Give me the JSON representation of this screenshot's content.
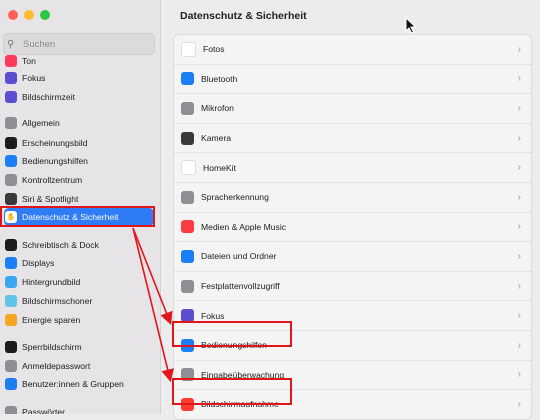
{
  "window": {
    "traffic_lights": [
      {
        "name": "close",
        "color": "#ff5f57"
      },
      {
        "name": "minimize",
        "color": "#febc2e"
      },
      {
        "name": "zoom",
        "color": "#28c840"
      }
    ]
  },
  "sidebar": {
    "search_placeholder": "Suchen",
    "items": [
      {
        "label": "Ton",
        "icon": "speaker-icon",
        "color": "#ff3b5c"
      },
      {
        "label": "Fokus",
        "icon": "moon-icon",
        "color": "#5b4fcf"
      },
      {
        "label": "Bildschirmzeit",
        "icon": "hourglass-icon",
        "color": "#5b4fcf"
      },
      {
        "label": "Allgemein",
        "icon": "gear-icon",
        "color": "#8e8e93"
      },
      {
        "label": "Erscheinungsbild",
        "icon": "appearance-icon",
        "color": "#1c1c1e"
      },
      {
        "label": "Bedienungshilfen",
        "icon": "accessibility-icon",
        "color": "#1a7ef5"
      },
      {
        "label": "Kontrollzentrum",
        "icon": "control-center-icon",
        "color": "#8e8e93"
      },
      {
        "label": "Siri & Spotlight",
        "icon": "siri-icon",
        "color": "#3a3a3c"
      },
      {
        "label": "Datenschutz & Sicherheit",
        "icon": "hand-icon",
        "color": "#2f7cf6",
        "active": true
      },
      {
        "label": "Schreibtisch & Dock",
        "icon": "dock-icon",
        "color": "#1c1c1e"
      },
      {
        "label": "Displays",
        "icon": "sun-icon",
        "color": "#1a7ef5"
      },
      {
        "label": "Hintergrundbild",
        "icon": "wallpaper-icon",
        "color": "#3aa6f0"
      },
      {
        "label": "Bildschirmschoner",
        "icon": "screensaver-icon",
        "color": "#5fc4e8"
      },
      {
        "label": "Energie sparen",
        "icon": "battery-icon",
        "color": "#f5a623"
      },
      {
        "label": "Sperrbildschirm",
        "icon": "lock-screen-icon",
        "color": "#1c1c1e"
      },
      {
        "label": "Anmeldepasswort",
        "icon": "lock-icon",
        "color": "#8e8e93"
      },
      {
        "label": "Benutzer:innen & Gruppen",
        "icon": "users-icon",
        "color": "#1a7ef5"
      },
      {
        "label": "Passwörter",
        "icon": "key-icon",
        "color": "#8e8e93"
      }
    ]
  },
  "main": {
    "title": "Datenschutz & Sicherheit",
    "rows": [
      {
        "label": "Fotos",
        "icon": "photos-icon",
        "color": "#ffffff"
      },
      {
        "label": "Bluetooth",
        "icon": "bluetooth-icon",
        "color": "#1a7ef5"
      },
      {
        "label": "Mikrofon",
        "icon": "microphone-icon",
        "color": "#8e8e93"
      },
      {
        "label": "Kamera",
        "icon": "camera-icon",
        "color": "#3a3a3c"
      },
      {
        "label": "HomeKit",
        "icon": "home-icon",
        "color": "#ffffff"
      },
      {
        "label": "Spracherkennung",
        "icon": "waveform-icon",
        "color": "#8e8e93"
      },
      {
        "label": "Medien & Apple Music",
        "icon": "music-icon",
        "color": "#fc3c44"
      },
      {
        "label": "Dateien und Ordner",
        "icon": "folder-icon",
        "color": "#1a7ef5"
      },
      {
        "label": "Festplattenvollzugriff",
        "icon": "disk-icon",
        "color": "#8e8e93"
      },
      {
        "label": "Fokus",
        "icon": "moon-icon",
        "color": "#5b4fcf"
      },
      {
        "label": "Bedienungshilfen",
        "icon": "accessibility-icon",
        "color": "#1a7ef5"
      },
      {
        "label": "Eingabeüberwachung",
        "icon": "keyboard-icon",
        "color": "#8e8e93"
      },
      {
        "label": "Bildschirmaufnahme",
        "icon": "record-icon",
        "color": "#ff3b30"
      }
    ]
  },
  "annotation_color": "#e0161d"
}
